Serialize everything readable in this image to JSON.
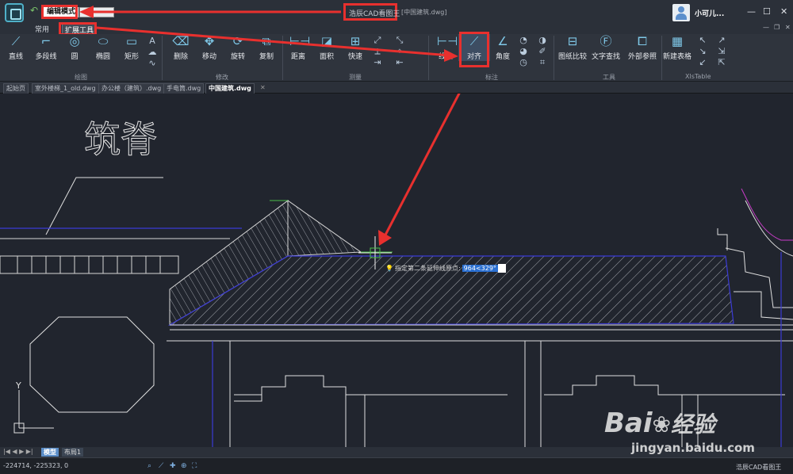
{
  "title": {
    "mode": "编辑模式",
    "app": "浩辰CAD看图王",
    "doc": "[中国建筑.dwg]",
    "user": "小可儿..."
  },
  "ribbon_tabs": [
    "常用",
    "扩展工具"
  ],
  "draw": [
    "直线",
    "多段线",
    "圆",
    "椭圆",
    "矩形"
  ],
  "modify": [
    "删除",
    "移动",
    "旋转",
    "复制"
  ],
  "measure": [
    "距离",
    "面积",
    "快速"
  ],
  "annotate": [
    "线性",
    "对齐",
    "角度"
  ],
  "tools": [
    "图纸比较",
    "文字查找",
    "外部参照"
  ],
  "xls": [
    "新建表格"
  ],
  "groups": [
    "绘图",
    "修改",
    "测量",
    "标注",
    "工具",
    "XlsTable"
  ],
  "doc_tabs": [
    "起始页",
    "室外楼梯_1_old.dwg",
    "办公楼（建筑）.dwg",
    "手电筒.dwg",
    "中国建筑.dwg"
  ],
  "canvas_text": "筑脊",
  "prompt": {
    "text": "指定第二条延伸线原点:",
    "value": "964<329°"
  },
  "layout_tabs": [
    "模型",
    "布局1"
  ],
  "status": {
    "coords": "-224714, -225323, 0",
    "brand": "浩辰CAD看图王"
  },
  "watermark": {
    "brand": "Bai",
    "brand2": "经验",
    "url": "jingyan.baidu.com"
  },
  "colors": {
    "accent": "#e8302e",
    "canvas": "#21252e",
    "outline": "#3b3bd6"
  }
}
